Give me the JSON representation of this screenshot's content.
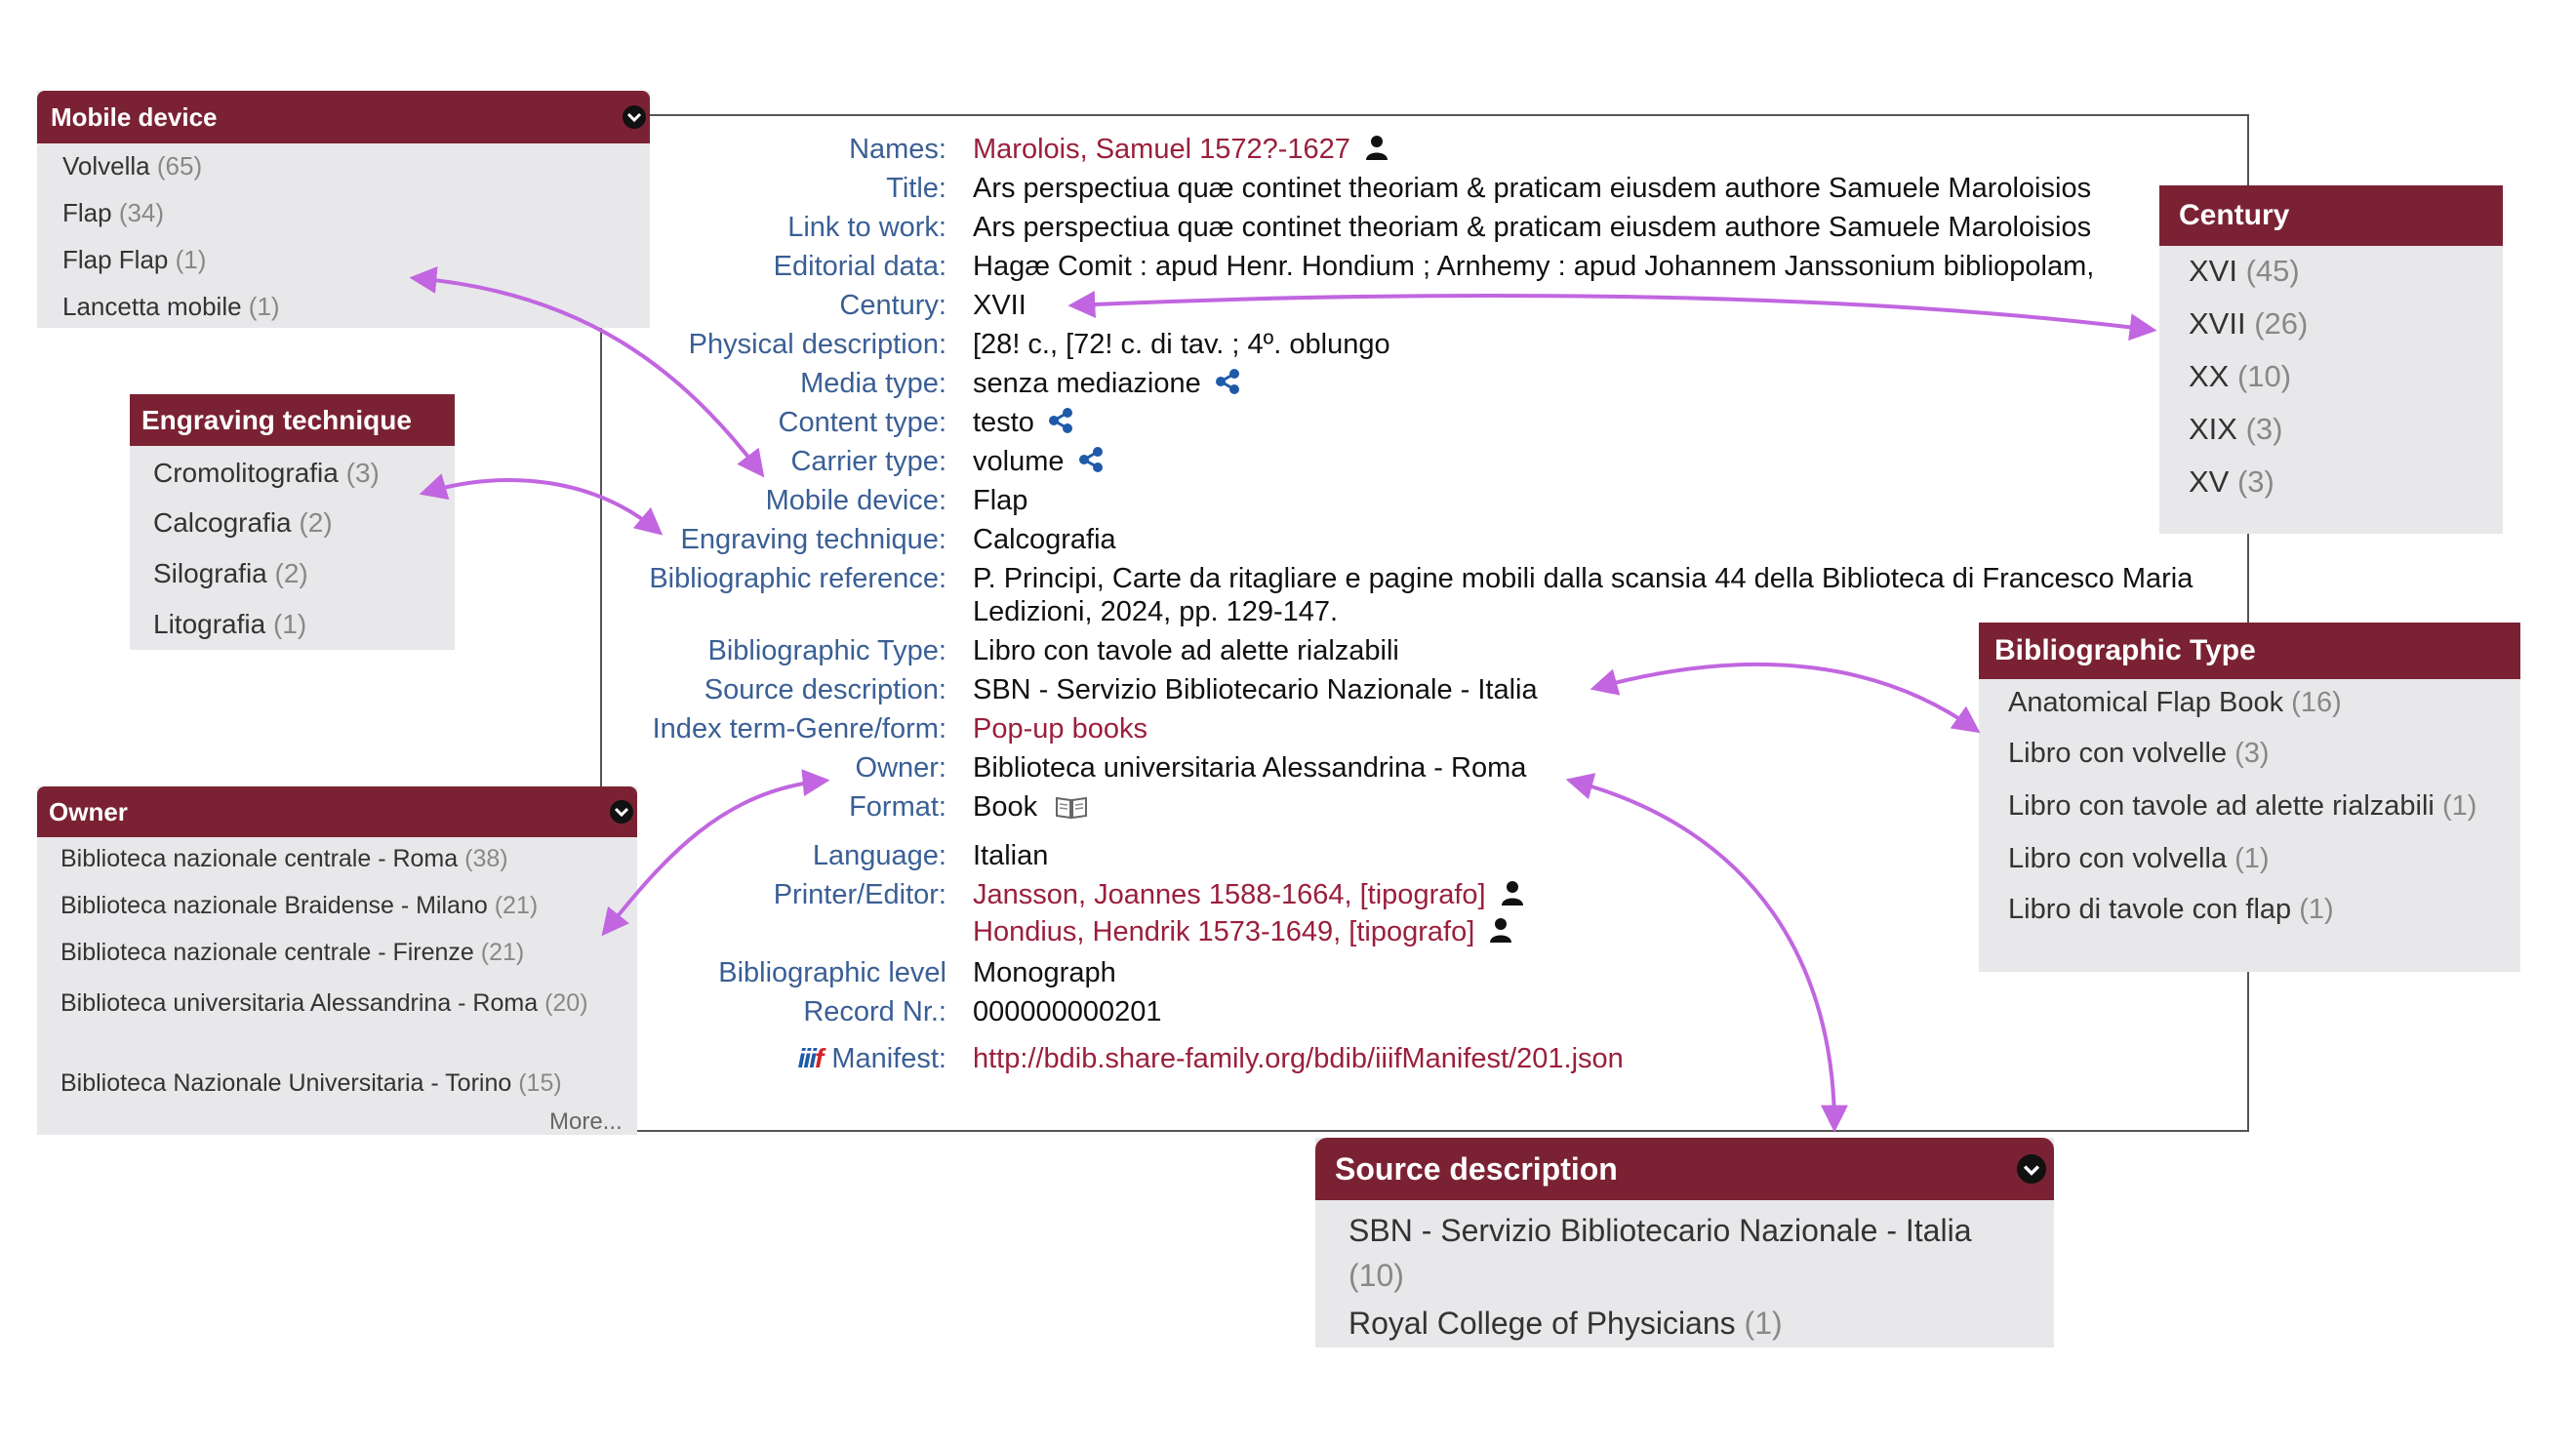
{
  "record": {
    "rows": [
      {
        "label": "Names:",
        "value": "Marolois, Samuel 1572?-1627",
        "type": "person-link"
      },
      {
        "label": "Title:",
        "value": "Ars perspectiua quæ continet theoriam & praticam eiusdem authore Samuele Maroloisios"
      },
      {
        "label": "Link to work:",
        "value": "Ars perspectiua quæ continet theoriam & praticam eiusdem authore Samuele Maroloisios"
      },
      {
        "label": "Editorial data:",
        "value": "Hagæ Comit : apud Henr. Hondium ; Arnhemy : apud Johannem Janssonium bibliopolam,"
      },
      {
        "label": "Century:",
        "value": "XVII"
      },
      {
        "label": "Physical description:",
        "value": "[28! c., [72! c. di tav. ; 4º. oblungo"
      },
      {
        "label": "Media type:",
        "value": "senza mediazione",
        "type": "share"
      },
      {
        "label": "Content type:",
        "value": "testo",
        "type": "share"
      },
      {
        "label": "Carrier type:",
        "value": "volume",
        "type": "share"
      },
      {
        "label": "Mobile device:",
        "value": "Flap"
      },
      {
        "label": "Engraving technique:",
        "value": "Calcografia"
      },
      {
        "label": "Bibliographic reference:",
        "value": "P. Principi, Carte da ritagliare e pagine mobili dalla scansia 44 della Biblioteca di Francesco Maria",
        "value2": "Ledizioni, 2024, pp. 129-147."
      },
      {
        "label": "Bibliographic Type:",
        "value": "Libro con tavole ad alette rialzabili"
      },
      {
        "label": "Source description:",
        "value": "SBN - Servizio Bibliotecario Nazionale - Italia"
      },
      {
        "label": "Index term-Genre/form:",
        "value": "Pop-up books",
        "type": "link"
      },
      {
        "label": "Owner:",
        "value": "Biblioteca universitaria Alessandrina - Roma"
      },
      {
        "label": "Format:",
        "value": "Book",
        "type": "book"
      },
      {
        "label": "Language:",
        "value": "Italian"
      },
      {
        "label": "Printer/Editor:",
        "value": "Jansson, Joannes 1588-1664, [tipografo]",
        "value2": "Hondius, Hendrik 1573-1649, [tipografo]",
        "type": "person-link2"
      },
      {
        "label": "Bibliographic level",
        "value": "Monograph"
      },
      {
        "label": "Record Nr.:",
        "value": "000000000201"
      },
      {
        "label": "Manifest:",
        "value": "http://bdib.share-family.org/bdib/iiifManifest/201.json",
        "type": "manifest"
      }
    ]
  },
  "facets": {
    "mobile_device": {
      "title": "Mobile device",
      "items": [
        {
          "name": "Volvella",
          "count": "(65)"
        },
        {
          "name": "Flap",
          "count": "(34)"
        },
        {
          "name": "Flap Flap",
          "count": "(1)"
        },
        {
          "name": "Lancetta mobile",
          "count": "(1)"
        }
      ]
    },
    "engraving": {
      "title": "Engraving technique",
      "items": [
        {
          "name": "Cromolitografia",
          "count": "(3)"
        },
        {
          "name": "Calcografia",
          "count": "(2)"
        },
        {
          "name": "Silografia",
          "count": "(2)"
        },
        {
          "name": "Litografia",
          "count": "(1)"
        }
      ]
    },
    "owner": {
      "title": "Owner",
      "items": [
        {
          "name": "Biblioteca nazionale centrale - Roma",
          "count": "(38)"
        },
        {
          "name": "Biblioteca nazionale Braidense - Milano",
          "count": "(21)"
        },
        {
          "name": "Biblioteca nazionale centrale - Firenze",
          "count": "(21)"
        },
        {
          "name": "Biblioteca universitaria Alessandrina - Roma",
          "count": "(20)"
        },
        {
          "name": "Biblioteca Nazionale Universitaria - Torino",
          "count": "(15)"
        }
      ],
      "more": "More..."
    },
    "century": {
      "title": "Century",
      "items": [
        {
          "name": "XVI",
          "count": "(45)"
        },
        {
          "name": "XVII",
          "count": "(26)"
        },
        {
          "name": "XX",
          "count": "(10)"
        },
        {
          "name": "XIX",
          "count": "(3)"
        },
        {
          "name": "XV",
          "count": "(3)"
        }
      ]
    },
    "bib_type": {
      "title": "Bibliographic Type",
      "items": [
        {
          "name": "Anatomical Flap Book",
          "count": "(16)"
        },
        {
          "name": "Libro con volvelle",
          "count": "(3)"
        },
        {
          "name": "Libro con tavole ad alette rialzabili",
          "count": "(1)"
        },
        {
          "name": "Libro con volvella",
          "count": "(1)"
        },
        {
          "name": "Libro di tavole con flap",
          "count": "(1)"
        }
      ]
    },
    "source": {
      "title": "Source description",
      "items": [
        {
          "name": "SBN - Servizio Bibliotecario Nazionale - Italia",
          "count": "(10)"
        },
        {
          "name": "Royal College of Physicians",
          "count": "(1)"
        }
      ]
    }
  },
  "colors": {
    "facet_header": "#7a2233",
    "label": "#3a5f95",
    "link": "#9a1f3c",
    "arrow": "#c166e0",
    "facet_bg": "#e8e8ea"
  },
  "icons": {
    "person": "person-icon",
    "share": "share-icon",
    "book": "book-icon",
    "chevron": "chevron-down-icon",
    "iiif": "iiif-logo-icon"
  }
}
